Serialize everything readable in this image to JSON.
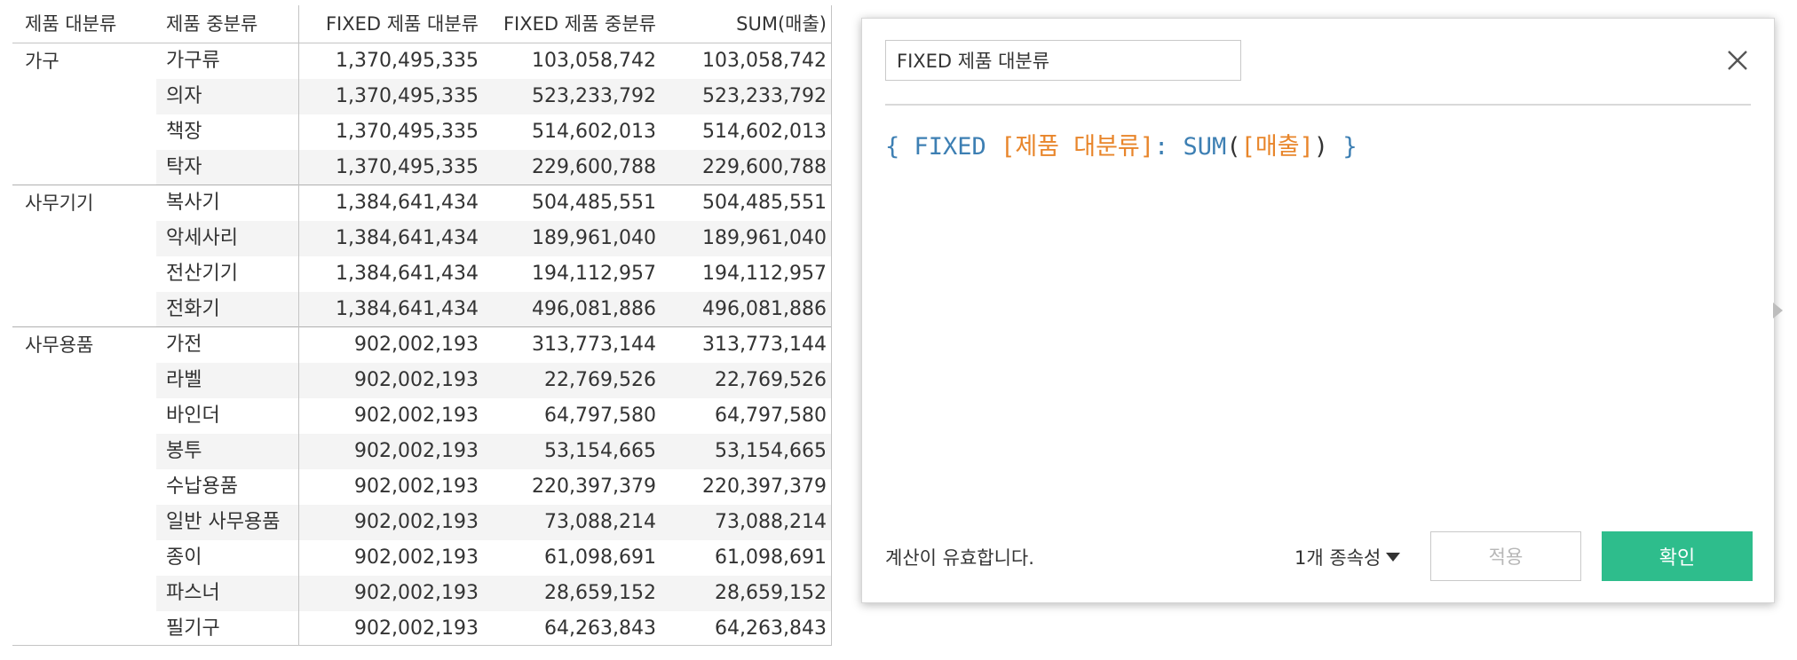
{
  "table": {
    "headers": {
      "category": "제품 대분류",
      "subcategory": "제품 중분류",
      "fixed_category": "FIXED 제품 대분류",
      "fixed_subcategory": "FIXED 제품 중분류",
      "sum_sales": "SUM(매출)"
    },
    "groups": [
      {
        "name": "가구",
        "rows": [
          {
            "sub": "가구류",
            "fixed_cat": "1,370,495,335",
            "fixed_sub": "103,058,742",
            "sum": "103,058,742"
          },
          {
            "sub": "의자",
            "fixed_cat": "1,370,495,335",
            "fixed_sub": "523,233,792",
            "sum": "523,233,792"
          },
          {
            "sub": "책장",
            "fixed_cat": "1,370,495,335",
            "fixed_sub": "514,602,013",
            "sum": "514,602,013"
          },
          {
            "sub": "탁자",
            "fixed_cat": "1,370,495,335",
            "fixed_sub": "229,600,788",
            "sum": "229,600,788"
          }
        ]
      },
      {
        "name": "사무기기",
        "rows": [
          {
            "sub": "복사기",
            "fixed_cat": "1,384,641,434",
            "fixed_sub": "504,485,551",
            "sum": "504,485,551"
          },
          {
            "sub": "악세사리",
            "fixed_cat": "1,384,641,434",
            "fixed_sub": "189,961,040",
            "sum": "189,961,040"
          },
          {
            "sub": "전산기기",
            "fixed_cat": "1,384,641,434",
            "fixed_sub": "194,112,957",
            "sum": "194,112,957"
          },
          {
            "sub": "전화기",
            "fixed_cat": "1,384,641,434",
            "fixed_sub": "496,081,886",
            "sum": "496,081,886"
          }
        ]
      },
      {
        "name": "사무용품",
        "rows": [
          {
            "sub": "가전",
            "fixed_cat": "902,002,193",
            "fixed_sub": "313,773,144",
            "sum": "313,773,144"
          },
          {
            "sub": "라벨",
            "fixed_cat": "902,002,193",
            "fixed_sub": "22,769,526",
            "sum": "22,769,526"
          },
          {
            "sub": "바인더",
            "fixed_cat": "902,002,193",
            "fixed_sub": "64,797,580",
            "sum": "64,797,580"
          },
          {
            "sub": "봉투",
            "fixed_cat": "902,002,193",
            "fixed_sub": "53,154,665",
            "sum": "53,154,665"
          },
          {
            "sub": "수납용품",
            "fixed_cat": "902,002,193",
            "fixed_sub": "220,397,379",
            "sum": "220,397,379"
          },
          {
            "sub": "일반 사무용품",
            "fixed_cat": "902,002,193",
            "fixed_sub": "73,088,214",
            "sum": "73,088,214"
          },
          {
            "sub": "종이",
            "fixed_cat": "902,002,193",
            "fixed_sub": "61,098,691",
            "sum": "61,098,691"
          },
          {
            "sub": "파스너",
            "fixed_cat": "902,002,193",
            "fixed_sub": "28,659,152",
            "sum": "28,659,152"
          },
          {
            "sub": "필기구",
            "fixed_cat": "902,002,193",
            "fixed_sub": "64,263,843",
            "sum": "64,263,843"
          }
        ]
      }
    ]
  },
  "dialog": {
    "name_value": "FIXED 제품 대분류",
    "formula": {
      "open_brace": "{ ",
      "keyword_fixed": "FIXED",
      "space": " ",
      "field_dimension": "[제품 대분류]",
      "colon": ": ",
      "func_sum": "SUM",
      "paren_open": "(",
      "field_measure": "[매출]",
      "paren_close": ")",
      "close_brace": " }"
    },
    "status_text": "계산이 유효합니다.",
    "dependencies_label": "1개 종속성",
    "apply_label": "적용",
    "ok_label": "확인"
  },
  "colors": {
    "formula_keyword": "#3d7fb3",
    "formula_field": "#e8852a",
    "ok_button": "#2ebd8c",
    "row_shade": "#f4f4f4"
  },
  "icons": {
    "close": "close-icon",
    "dropdown": "caret-down-icon",
    "expand": "expand-arrow-icon"
  }
}
